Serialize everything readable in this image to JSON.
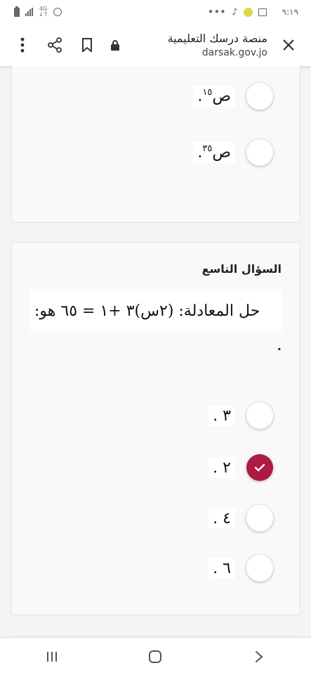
{
  "status_bar": {
    "time": "٩:١٩",
    "network": "4G",
    "network_sub": "↓↑",
    "more": "•••"
  },
  "browser": {
    "page_title": "منصة درسك التعليمية",
    "url": "darsak.gov.jo"
  },
  "question8": {
    "options": [
      {
        "text": "ص",
        "exp": "١٥",
        "suffix": ".",
        "checked": false
      },
      {
        "text": "ص",
        "exp": "٣٥",
        "suffix": ".",
        "checked": false
      }
    ]
  },
  "question9": {
    "title": "السؤال التاسع",
    "equation": "حل المعادلة: (٢س)٣ +١ = ٦٥ هو:",
    "trailing_dot": ".",
    "options": [
      {
        "text": "٣",
        "suffix": ".",
        "checked": false
      },
      {
        "text": "٢",
        "suffix": ".",
        "checked": true
      },
      {
        "text": "٤",
        "suffix": ".",
        "checked": false
      },
      {
        "text": "٦",
        "suffix": ".",
        "checked": false
      }
    ]
  },
  "colors": {
    "accent": "#ad1a44",
    "card_bg": "#f9f9f9"
  }
}
